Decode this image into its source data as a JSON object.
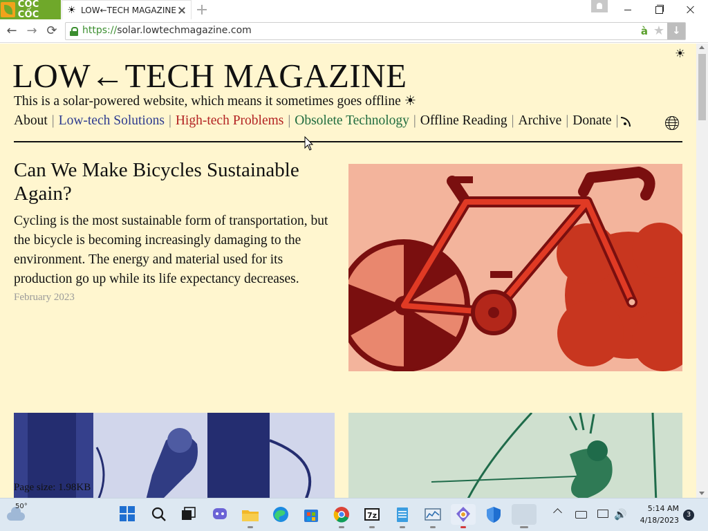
{
  "browser": {
    "brand": "CỐC CỐC",
    "tab": {
      "title": "LOW←TECH MAGAZINE",
      "favicon": "sun-icon"
    },
    "address": {
      "protocol": "https://",
      "host": "solar.lowtechmagazine.com"
    },
    "toolbar": {
      "back": "←",
      "forward": "→",
      "reload": "⟳",
      "extension": "à",
      "star": "★"
    }
  },
  "page": {
    "theme_toggle": "☀",
    "site_title": "LOW←TECH MAGAZINE",
    "tagline": "This is a solar-powered website, which means it sometimes goes offline ☀",
    "nav": [
      {
        "label": "About",
        "style": "plain"
      },
      {
        "label": "Low-tech Solutions",
        "style": "lowtech"
      },
      {
        "label": "High-tech Problems",
        "style": "hightech"
      },
      {
        "label": "Obsolete Technology",
        "style": "obsolete"
      },
      {
        "label": "Offline Reading",
        "style": "plain"
      },
      {
        "label": "Archive",
        "style": "plain"
      },
      {
        "label": "Donate",
        "style": "plain"
      }
    ],
    "nav_separator": "|",
    "featured": {
      "title": "Can We Make Bicycles Sustainable Again?",
      "summary": "Cycling is the most sustainable form of transportation, but the bicycle is becoming increasingly damaging to the environment. The energy and material used for its production go up while its life expectancy decreases.",
      "date": "February 2023"
    },
    "page_size": "Page size: 1.98KB"
  },
  "colors": {
    "page_background": "#fff6cf",
    "lowtech": "#2d3b8f",
    "hightech": "#b22222",
    "obsolete": "#1e6b3e",
    "brand_green": "#6fa82a"
  },
  "taskbar": {
    "weather_temp": "50°",
    "time": "5:14 AM",
    "date": "4/18/2023",
    "notifications": "3",
    "apps": [
      "start-icon",
      "search-icon",
      "task-view-icon",
      "teams-chat-icon",
      "file-explorer-icon",
      "edge-icon",
      "store-icon",
      "chrome-icon",
      "7zip-icon",
      "notepad-icon",
      "resource-monitor-icon",
      "coccoc-icon",
      "defender-icon",
      "blank-window-icon"
    ],
    "labels": {
      "sevenzip": "7z",
      "volume": "🔊"
    }
  }
}
